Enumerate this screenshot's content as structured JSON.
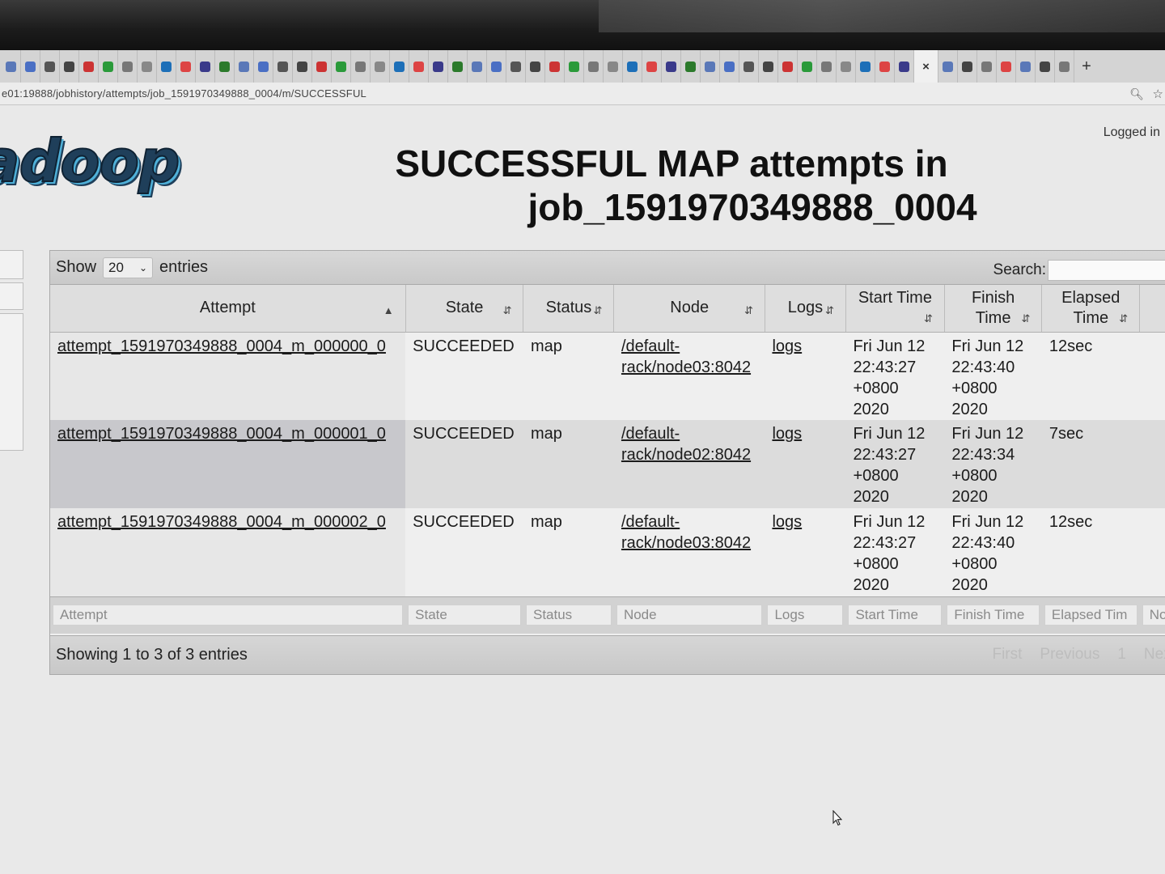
{
  "browser": {
    "url": "e01:19888/jobhistory/attempts/job_1591970349888_0004/m/SUCCESSFUL",
    "close_tab_glyph": "×",
    "new_tab_glyph": "+"
  },
  "header": {
    "logo_text": "adoop",
    "logged_in": "Logged in",
    "title_line1": "SUCCESSFUL MAP attempts in",
    "title_line2": "job_1591970349888_0004"
  },
  "table_controls": {
    "show_label": "Show",
    "page_length": "20",
    "entries_label": "entries",
    "search_label": "Search:"
  },
  "columns": {
    "attempt": "Attempt",
    "state": "State",
    "status": "Status",
    "node": "Node",
    "logs": "Logs",
    "start_time": "Start Time",
    "finish_time_1": "Finish",
    "finish_time_2": "Time",
    "elapsed_1": "Elapsed",
    "elapsed_2": "Time"
  },
  "rows": [
    {
      "attempt": "attempt_1591970349888_0004_m_000000_0",
      "state": "SUCCEEDED",
      "status": "map",
      "node_1": "/default-",
      "node_2": "rack/node03:8042",
      "logs": "logs",
      "start": [
        "Fri Jun 12",
        "22:43:27",
        "+0800",
        "2020"
      ],
      "finish": [
        "Fri Jun 12",
        "22:43:40",
        "+0800",
        "2020"
      ],
      "elapsed": "12sec"
    },
    {
      "attempt": "attempt_1591970349888_0004_m_000001_0",
      "state": "SUCCEEDED",
      "status": "map",
      "node_1": "/default-",
      "node_2": "rack/node02:8042",
      "logs": "logs",
      "start": [
        "Fri Jun 12",
        "22:43:27",
        "+0800",
        "2020"
      ],
      "finish": [
        "Fri Jun 12",
        "22:43:34",
        "+0800",
        "2020"
      ],
      "elapsed": "7sec"
    },
    {
      "attempt": "attempt_1591970349888_0004_m_000002_0",
      "state": "SUCCEEDED",
      "status": "map",
      "node_1": "/default-",
      "node_2": "rack/node03:8042",
      "logs": "logs",
      "start": [
        "Fri Jun 12",
        "22:43:27",
        "+0800",
        "2020"
      ],
      "finish": [
        "Fri Jun 12",
        "22:43:40",
        "+0800",
        "2020"
      ],
      "elapsed": "12sec"
    }
  ],
  "filters": {
    "attempt": "Attempt",
    "state": "State",
    "status": "Status",
    "node": "Node",
    "logs": "Logs",
    "start_time": "Start Time",
    "finish_time": "Finish Time",
    "elapsed_time": "Elapsed Tim",
    "next_col": "No"
  },
  "footer": {
    "info": "Showing 1 to 3 of 3 entries",
    "first": "First",
    "previous": "Previous",
    "page": "1",
    "next": "Next"
  },
  "colors": {
    "logo_fill": "#1f3f5a",
    "logo_shadow": "#4fb0d8",
    "selected_row": "#c8c8cc"
  }
}
